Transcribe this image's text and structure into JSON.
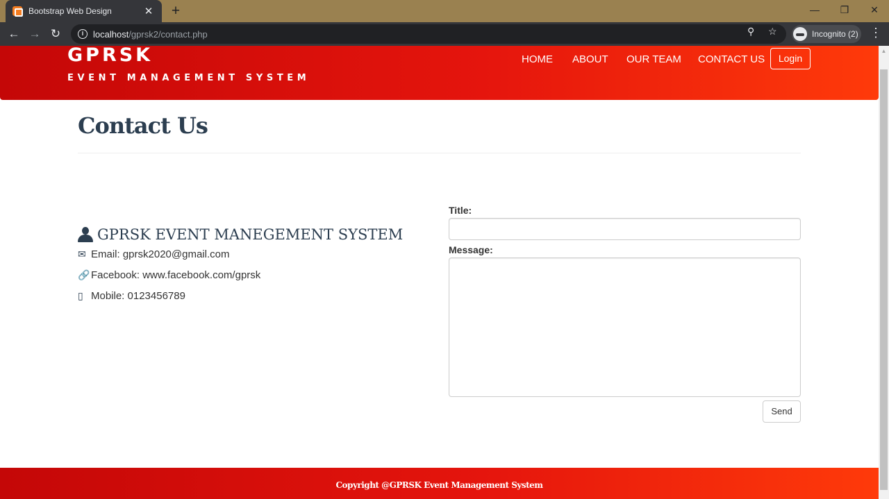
{
  "browser": {
    "tab_title": "Bootstrap Web Design",
    "tab_close": "✕",
    "new_tab": "+",
    "url_host": "localhost",
    "url_path": "/gprsk2/contact.php",
    "incognito_label": "Incognito (2)",
    "icons": [
      "close-icon",
      "plus-icon",
      "back-arrow-icon",
      "forward-arrow-icon",
      "reload-icon",
      "info-icon",
      "key-icon",
      "star-icon",
      "incognito-icon",
      "menu-icon"
    ]
  },
  "navbar": {
    "brand_title": "GPRSK",
    "brand_subtitle": "EVENT MANAGEMENT SYSTEM",
    "links": [
      "HOME",
      "ABOUT",
      "OUR TEAM",
      "CONTACT US"
    ],
    "login_label": "Login",
    "colors": {
      "gradient_start": "#c40707",
      "gradient_end": "#ff3a0a"
    }
  },
  "page": {
    "title": "Contact Us"
  },
  "contact": {
    "company_name": "GPRSK EVENT MANEGEMENT SYSTEM",
    "email": "Email: gprsk2020@gmail.com",
    "facebook": "Facebook: www.facebook.com/gprsk",
    "mobile": "Mobile: 0123456789",
    "icons": [
      "user-icon",
      "envelope-icon",
      "link-icon",
      "phone-icon"
    ]
  },
  "form": {
    "title_label": "Title:",
    "title_value": "",
    "message_label": "Message:",
    "message_value": "",
    "send_label": "Send"
  },
  "footer": {
    "text": "Copyright @GPRSK Event Management System"
  }
}
